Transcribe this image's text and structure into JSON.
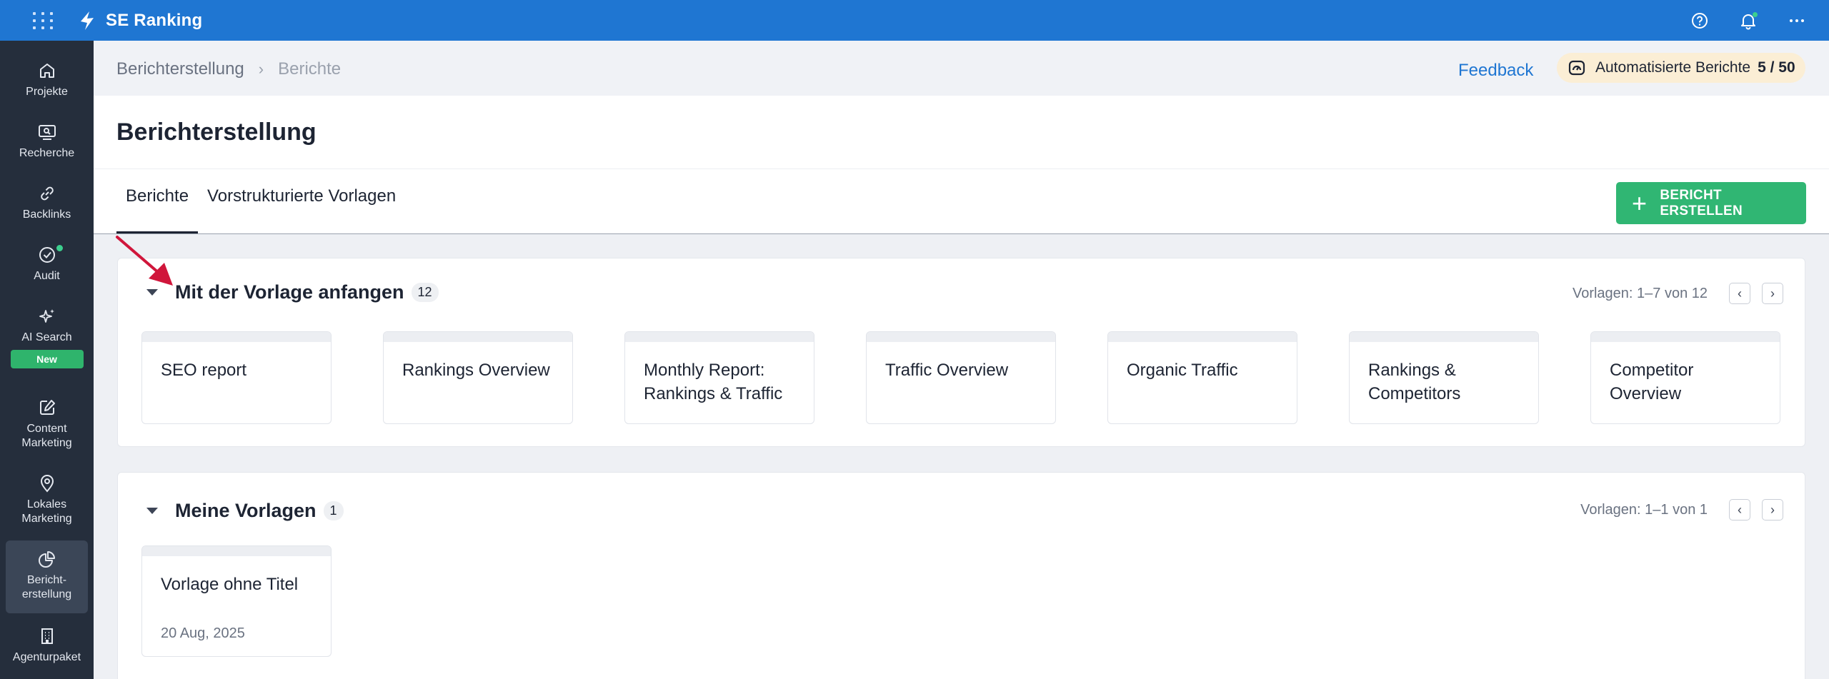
{
  "app": {
    "name": "SE Ranking"
  },
  "sidebar": {
    "items": [
      {
        "label": "Projekte",
        "icon": "home-icon"
      },
      {
        "label": "Recherche",
        "icon": "monitor-search-icon"
      },
      {
        "label": "Backlinks",
        "icon": "link-icon"
      },
      {
        "label": "Audit",
        "icon": "check-circle-icon"
      },
      {
        "label": "AI Search",
        "icon": "sparkles-icon",
        "badge": "New"
      },
      {
        "label": "Content Marketing",
        "icon": "edit-icon"
      },
      {
        "label": "Lokales Marketing",
        "icon": "map-pin-icon"
      },
      {
        "label": "Bericht-erstellung",
        "icon": "pie-chart-icon",
        "active": true
      },
      {
        "label": "Agenturpaket",
        "icon": "building-icon"
      }
    ]
  },
  "breadcrumb": {
    "root": "Berichterstellung",
    "current": "Berichte"
  },
  "header": {
    "feedback": "Feedback",
    "quota_label": "Automatisierte Berichte",
    "quota_value": "5 / 50"
  },
  "page": {
    "title": "Berichterstellung",
    "tabs": [
      "Berichte",
      "Vorstrukturierte Vorlagen"
    ],
    "active_tab": "Berichte",
    "create_button": "BERICHT ERSTELLEN"
  },
  "template_section": {
    "title": "Mit der Vorlage anfangen",
    "count": "12",
    "pager_text": "Vorlagen: 1–7 von 12",
    "cards": [
      "SEO report",
      "Rankings Overview",
      "Monthly Report: Rankings & Traffic",
      "Traffic Overview",
      "Organic Traffic",
      "Rankings & Competitors",
      "Competitor Overview"
    ]
  },
  "my_section": {
    "title": "Meine Vorlagen",
    "count": "1",
    "pager_text": "Vorlagen: 1–1 von 1",
    "cards": [
      {
        "title": "Vorlage ohne Titel",
        "date": "20 Aug, 2025"
      }
    ]
  },
  "colors": {
    "topbar": "#1f76d2",
    "sidebar": "#252e3c",
    "accent_green": "#30b673",
    "annotation_arrow": "#d0163b"
  }
}
